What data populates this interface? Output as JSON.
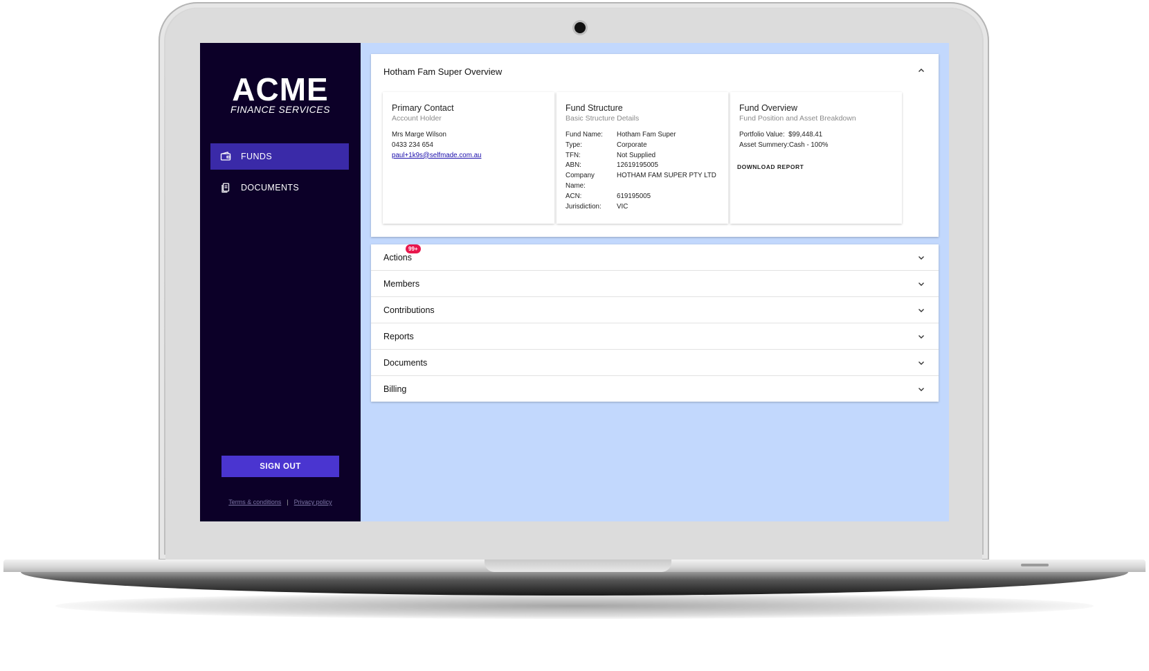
{
  "brand": {
    "main": "ACME",
    "sub": "FINANCE SERVICES"
  },
  "nav": [
    {
      "label": "FUNDS",
      "icon": "wallet-icon",
      "active": true
    },
    {
      "label": "DOCUMENTS",
      "icon": "documents-icon",
      "active": false
    }
  ],
  "signout": "SIGN OUT",
  "legal": {
    "terms": "Terms & conditions",
    "separator": "|",
    "privacy": "Privacy policy"
  },
  "overview": {
    "title": "Hotham Fam Super Overview",
    "primary_contact": {
      "title": "Primary Contact",
      "subtitle": "Account Holder",
      "name": "Mrs Marge Wilson",
      "phone": "0433 234 654",
      "email": "paul+1k9s@selfmade.com.au"
    },
    "fund_structure": {
      "title": "Fund Structure",
      "subtitle": "Basic Structure Details",
      "rows": [
        {
          "k": "Fund Name:",
          "v": "Hotham Fam Super"
        },
        {
          "k": "Type:",
          "v": "Corporate"
        },
        {
          "k": "TFN:",
          "v": "Not Supplied"
        },
        {
          "k": "ABN:",
          "v": "12619195005"
        },
        {
          "k": "Company Name:",
          "v": "HOTHAM FAM SUPER PTY LTD"
        },
        {
          "k": "ACN:",
          "v": "619195005"
        },
        {
          "k": "Jurisdiction:",
          "v": "VIC"
        }
      ]
    },
    "fund_overview": {
      "title": "Fund Overview",
      "subtitle": "Fund Position and Asset Breakdown",
      "portfolio_label": "Portfolio Value:",
      "portfolio_value": "$99,448.41",
      "asset_summary": "Asset Summery:Cash - 100%",
      "download": "DOWNLOAD REPORT"
    }
  },
  "sections": [
    {
      "label": "Actions",
      "badge": "99+"
    },
    {
      "label": "Members"
    },
    {
      "label": "Contributions"
    },
    {
      "label": "Reports"
    },
    {
      "label": "Documents"
    },
    {
      "label": "Billing"
    }
  ],
  "colors": {
    "sidebar": "#0c0028",
    "nav_active": "#3a2aa8",
    "signout": "#4a35d0",
    "content_bg": "#c2d8fd",
    "badge": "#e8174d"
  }
}
